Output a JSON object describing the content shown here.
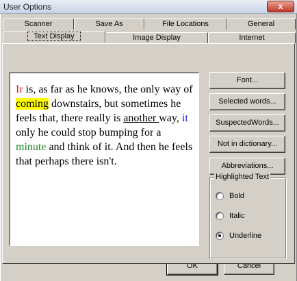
{
  "window": {
    "title": "User Options",
    "close_glyph": "x"
  },
  "tabs_row1": [
    {
      "label": "Scanner"
    },
    {
      "label": "Save As"
    },
    {
      "label": "File Locations"
    },
    {
      "label": "General"
    }
  ],
  "tabs_row2": [
    {
      "label": "Text Display",
      "active": true
    },
    {
      "label": "Image Display"
    },
    {
      "label": "Internet"
    }
  ],
  "preview": {
    "seg01": "Ir",
    "seg02": " is, as far as he knows, the only way of ",
    "seg03": "coming",
    "seg04": " downstairs, but sometimes he feels that, there really is ",
    "seg05": "another ",
    "seg06": "way, ",
    "seg07": "it",
    "seg08": " only he could stop bumping for a ",
    "seg09": "minute",
    "seg10": " and think of it. And then he feels that perhaps there isn't.",
    "colors": {
      "misspelled": "#d42020",
      "suspected": "#1a1ae0",
      "not_in_dictionary": "#1f8a1f",
      "highlight": "#ffff00"
    }
  },
  "buttons": {
    "font": "Font...",
    "selected_words": "Selected words...",
    "suspected_words": "SuspectedWords...",
    "not_in_dictionary": "Not in dictionary...",
    "abbreviations": "Abbreviations..."
  },
  "highlighted_text": {
    "label": "Highlighted Text",
    "options": [
      {
        "label": "Bold",
        "checked": false
      },
      {
        "label": "Italic",
        "checked": false
      },
      {
        "label": "Underline",
        "checked": true
      }
    ]
  },
  "footer": {
    "ok": "OK",
    "cancel": "Cancel"
  }
}
